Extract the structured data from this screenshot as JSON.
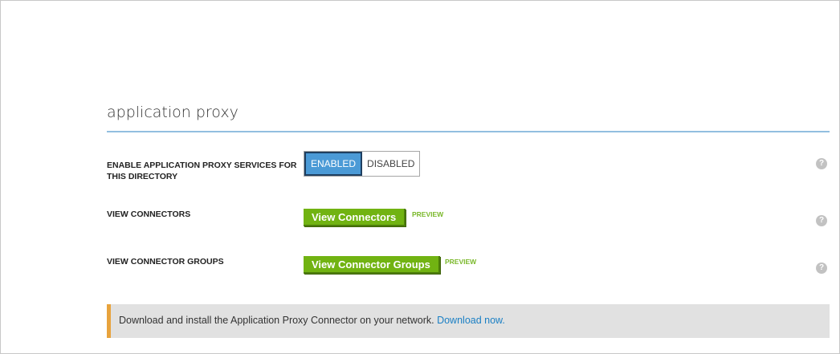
{
  "section": {
    "title": "application proxy"
  },
  "rows": {
    "enable": {
      "label": "ENABLE APPLICATION PROXY SERVICES FOR THIS DIRECTORY",
      "enabled_label": "ENABLED",
      "disabled_label": "DISABLED",
      "selected": "ENABLED"
    },
    "connectors": {
      "label": "VIEW CONNECTORS",
      "button_label": "View Connectors",
      "badge": "PREVIEW"
    },
    "groups": {
      "label": "VIEW CONNECTOR GROUPS",
      "button_label": "View Connector Groups",
      "badge": "PREVIEW"
    }
  },
  "help": {
    "glyph": "?"
  },
  "notice": {
    "text": "Download and install the Application Proxy Connector on your network.",
    "link_label": "Download now."
  },
  "colors": {
    "accent_blue": "#4b9ad6",
    "button_green": "#71b312",
    "notice_bar": "#e8a33d",
    "link": "#1a7fc4"
  },
  "icons": {
    "help": "question-circle-icon"
  }
}
